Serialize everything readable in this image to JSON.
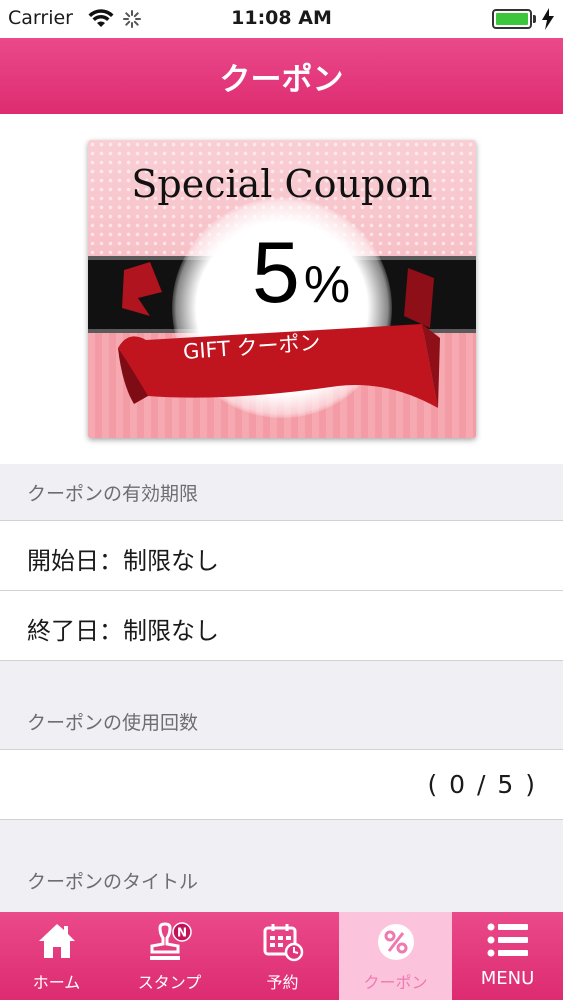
{
  "status_bar": {
    "carrier": "Carrier",
    "time": "11:08 AM",
    "battery_level": 1.0
  },
  "nav": {
    "title": "クーポン"
  },
  "coupon": {
    "heading": "Special Coupon",
    "discount_value": "5",
    "discount_unit": "%",
    "ribbon_text": "GIFT クーポン"
  },
  "validity": {
    "header": "クーポンの有効期限",
    "start": "開始日：制限なし",
    "end": "終了日：制限なし"
  },
  "usage": {
    "header": "クーポンの使用回数",
    "count": "( 0 / 5 )"
  },
  "title_section": {
    "header": "クーポンのタイトル"
  },
  "tabs": [
    {
      "label": "ホーム",
      "icon": "home-icon"
    },
    {
      "label": "スタンプ",
      "icon": "stamp-icon",
      "badge": "N"
    },
    {
      "label": "予約",
      "icon": "calendar-clock-icon"
    },
    {
      "label": "クーポン",
      "icon": "percent-icon",
      "active": true
    },
    {
      "label": "MENU",
      "icon": "menu-list-icon"
    }
  ],
  "colors": {
    "brand_pink": "#e0357a",
    "active_tab_bg": "#fbc4dc",
    "section_bg": "#efeff4",
    "battery_green": "#3cc63c"
  }
}
